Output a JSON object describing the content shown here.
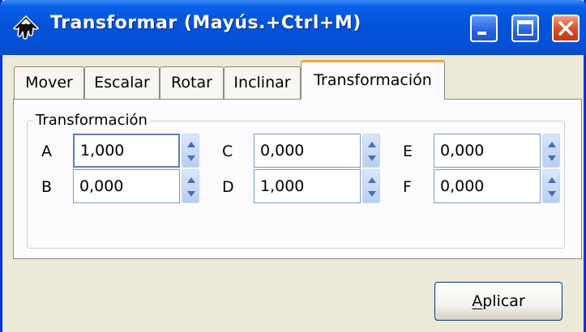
{
  "window": {
    "title": "Transformar (Mayús.+Ctrl+M)",
    "controls": [
      "minimize",
      "maximize",
      "close"
    ],
    "colors": {
      "titlebar": "#0352D8",
      "frame": "#0831D9",
      "face": "#ECE9D8",
      "active_tab_accent": "#F2A23A",
      "close_button": "#D8502A"
    }
  },
  "tabs": [
    {
      "label": "Mover",
      "active": false
    },
    {
      "label": "Escalar",
      "active": false
    },
    {
      "label": "Rotar",
      "active": false
    },
    {
      "label": "Inclinar",
      "active": false
    },
    {
      "label": "Transformación",
      "active": true
    }
  ],
  "group": {
    "label": "Transformación",
    "fields": [
      {
        "label": "A",
        "value": "1,000"
      },
      {
        "label": "B",
        "value": "0,000"
      },
      {
        "label": "C",
        "value": "0,000"
      },
      {
        "label": "D",
        "value": "1,000"
      },
      {
        "label": "E",
        "value": "0,000"
      },
      {
        "label": "F",
        "value": "0,000"
      }
    ]
  },
  "apply_button": {
    "label": "Aplicar",
    "mnemonic": "A"
  },
  "icons": {
    "app": "inkscape-icon",
    "spin": "spin-up-down-icon"
  }
}
